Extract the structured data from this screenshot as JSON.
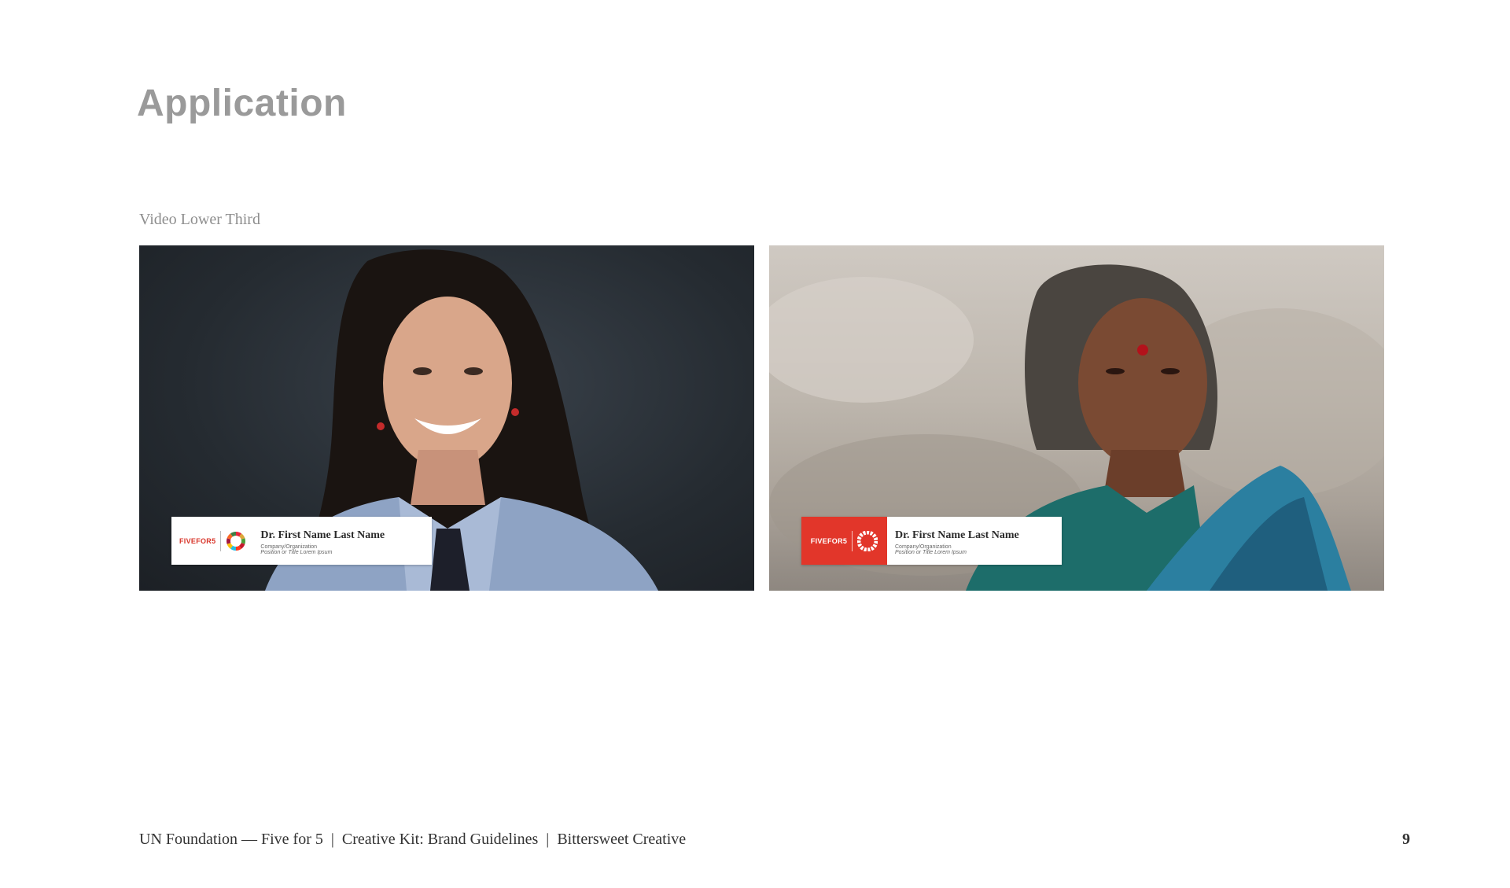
{
  "page": {
    "title": "Application",
    "section_label": "Video Lower Third",
    "page_number": "9"
  },
  "panels": [
    {
      "brand_text": "FIVEFOR5",
      "brand_style": "white-background",
      "name": "Dr. First Name Last Name",
      "organization": "Company/Organization",
      "position": "Position or Title Lorem Ipsum"
    },
    {
      "brand_text": "FIVEFOR5",
      "brand_style": "red-background",
      "name": "Dr. First Name Last Name",
      "organization": "Company/Organization",
      "position": "Position or Title Lorem Ipsum"
    }
  ],
  "footer": {
    "part1": "UN Foundation — Five for 5",
    "part2": "Creative Kit: Brand Guidelines",
    "part3": "Bittersweet Creative",
    "separator": "|"
  },
  "colors": {
    "brand_red": "#e2362a",
    "title_gray": "#9a9a9a"
  }
}
